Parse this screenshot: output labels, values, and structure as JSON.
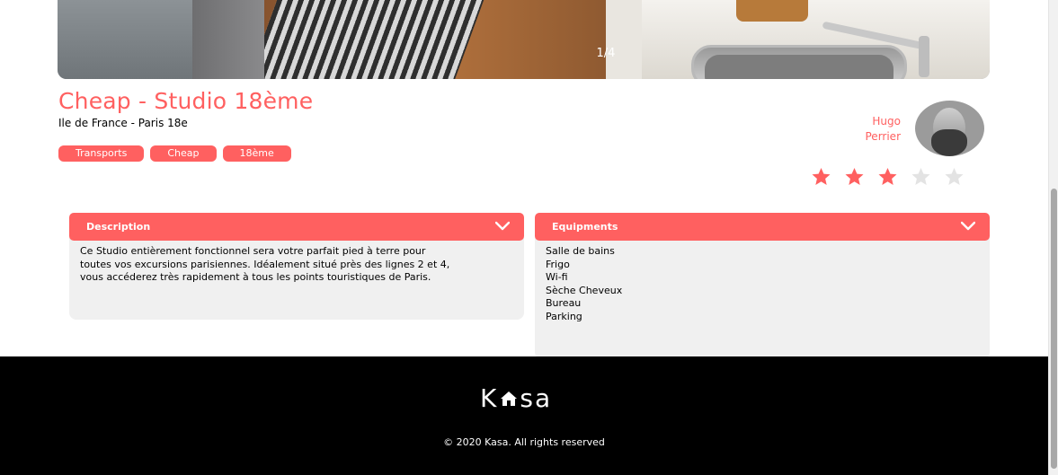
{
  "gallery": {
    "counter": "1/4",
    "current": 1,
    "total": 4
  },
  "listing": {
    "title": "Cheap - Studio 18ème",
    "location": "Ile de France - Paris 18e",
    "tags": [
      "Transports",
      "Cheap",
      "18ème"
    ]
  },
  "host": {
    "first_name": "Hugo",
    "last_name": "Perrier"
  },
  "rating": {
    "value": 3,
    "max": 5,
    "filled_color": "#ff6060",
    "empty_color": "#e3e3e3"
  },
  "description": {
    "title": "Description",
    "lines": [
      "Ce Studio entièrement fonctionnel sera votre parfait pied à terre pour",
      "toutes vos excursions parisiennes. Idéalement situé près des lignes 2 et 4,",
      "vous accéderez très rapidement à tous les points touristiques de Paris."
    ]
  },
  "equipments": {
    "title": "Equipments",
    "items": [
      "Salle de bains",
      "Frigo",
      "Wi-fi",
      "Sèche Cheveux",
      "Bureau",
      "Parking"
    ]
  },
  "footer": {
    "logo_left": "K",
    "logo_right": "sa",
    "copyright": "© 2020 Kasa. All rights reserved"
  },
  "colors": {
    "accent": "#ff6060",
    "panel_bg": "#f0f0f0",
    "footer_bg": "#000000"
  },
  "icons": {
    "collapse": "chevron-down-icon",
    "rating": "star-icon",
    "logo_mark": "house-icon"
  }
}
